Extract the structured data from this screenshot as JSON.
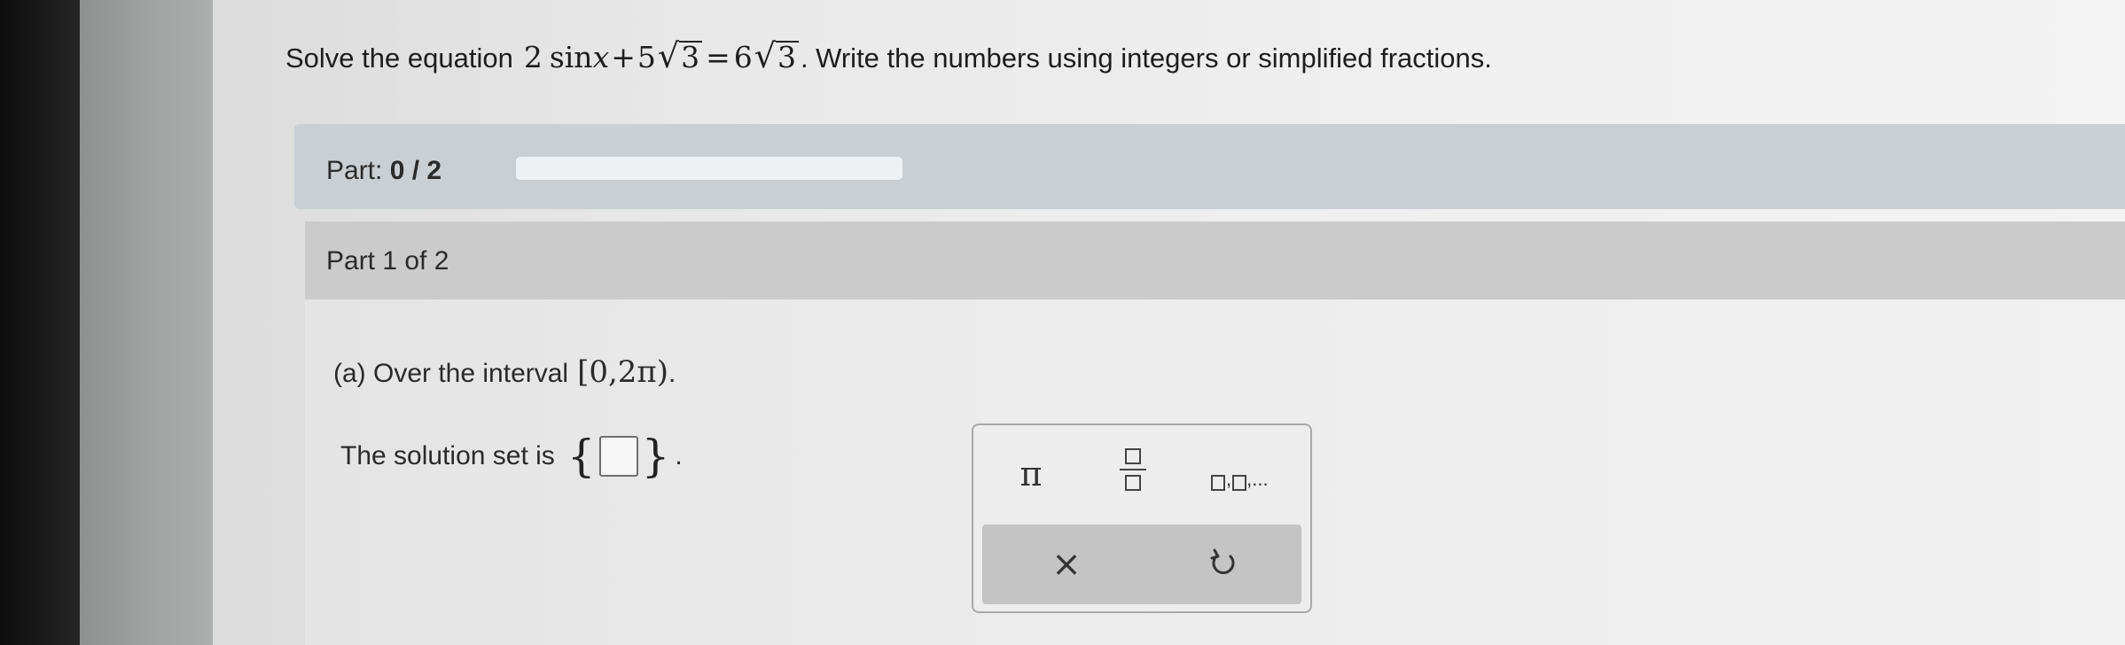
{
  "question": {
    "prefix": "Solve the equation",
    "equation": {
      "lhs_coef": "2",
      "func": "sin",
      "var": "x",
      "plus": "+",
      "lhs_root_coef": "5",
      "root_arg": "3",
      "equals": "=",
      "rhs_root_coef": "6"
    },
    "suffix": ". Write the numbers using integers or simplified fractions."
  },
  "progress": {
    "part_label": "Part:",
    "score": "0 / 2",
    "fraction_complete": 0
  },
  "part": {
    "header": "Part 1 of 2",
    "interval_prompt": "(a) Over the interval",
    "interval": "[0,2π)",
    "interval_end": ".",
    "solution_label": "The solution set is",
    "brace_open": "{",
    "brace_close": "}",
    "period": "."
  },
  "keypad": {
    "pi_key": "π",
    "list_sep": ",",
    "list_ellipsis": ",...",
    "clear_key": "×",
    "undo_icon": "undo-icon",
    "fraction_icon": "fraction-icon",
    "list_icon": "list-icon"
  }
}
